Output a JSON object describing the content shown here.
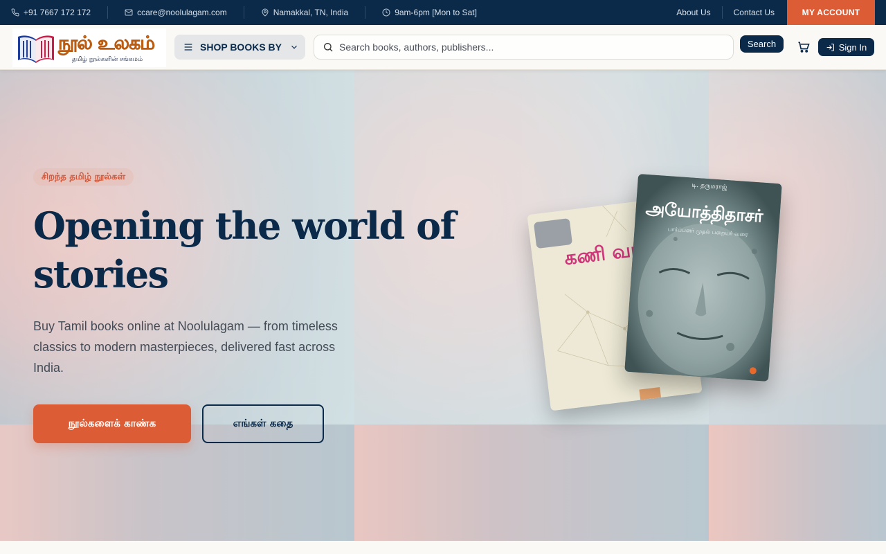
{
  "topbar": {
    "phone": "+91 7667 172 172",
    "email": "ccare@noolulagam.com",
    "location": "Namakkal, TN, India",
    "hours": "9am-6pm [Mon to Sat]",
    "about_label": "About Us",
    "contact_label": "Contact Us",
    "account_label": "MY ACCOUNT"
  },
  "header": {
    "logo_main": "நூல் உலகம்",
    "logo_sub": "தமிழ் நூல்களின் சங்கமம்",
    "shop_label": "SHOP BOOKS BY",
    "search_placeholder": "Search books, authors, publishers...",
    "search_button": "Search",
    "signin_label": "Sign In"
  },
  "hero": {
    "tag": "சிறந்த தமிழ் நூல்கள்",
    "title": "Opening the world of stories",
    "description": "Buy Tamil books online at Noolulagam — from timeless classics to modern masterpieces, delivered fast across India.",
    "primary_button": "நூல்களைக் காண்க",
    "secondary_button": "எங்கள் கதை"
  },
  "books": {
    "book1_title": "கணி வரல",
    "book2_author": "டி. தருமராஜ்",
    "book2_title": "அயோத்திதாசர்",
    "book2_subtitle": "பார்ப்பனர் முதல் பறையர் வரை"
  },
  "colors": {
    "navy": "#0b2a4a",
    "accent": "#dc5c36"
  }
}
